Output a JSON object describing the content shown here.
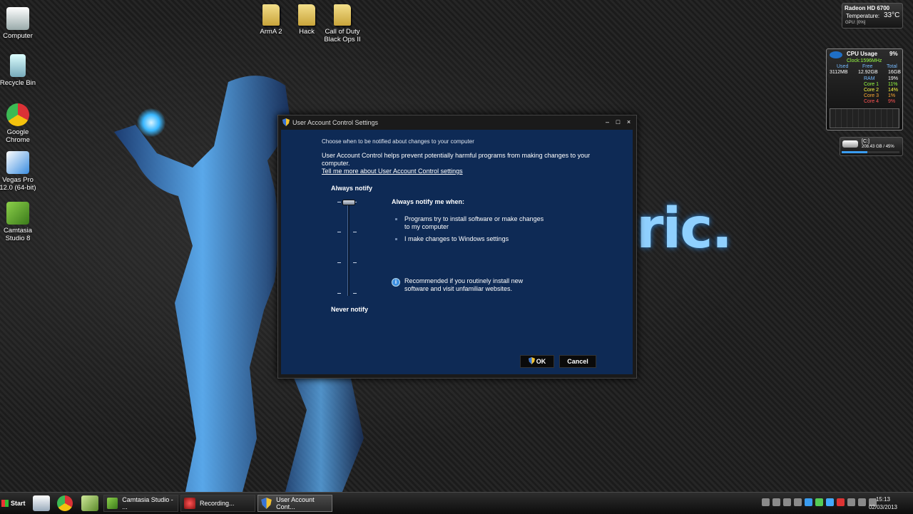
{
  "desktop": {
    "icons": [
      {
        "label": "Computer"
      },
      {
        "label": "Recycle Bin"
      },
      {
        "label": "Google Chrome"
      },
      {
        "label": "Vegas Pro 12.0 (64-bit)"
      },
      {
        "label": "Camtasia Studio 8"
      }
    ],
    "folders": [
      {
        "label": "ArmA 2"
      },
      {
        "label": "Hack"
      },
      {
        "label": "Call of Duty Black Ops II"
      }
    ],
    "brand_text": "ric."
  },
  "gadgets": {
    "gpu": {
      "name": "Radeon HD 6700",
      "temp_label": "Temperature:",
      "temp_value": "33°C",
      "gpu_load": "GPU: [0%]"
    },
    "cpu": {
      "title": "CPU Usage",
      "total": "9%",
      "clock": "Clock:1596MHz",
      "headers": [
        "Used",
        "Free",
        "Total"
      ],
      "memory": [
        "3112MB",
        "12.92GB",
        "16GB"
      ],
      "rows": [
        {
          "label": "RAM",
          "value": "19%"
        },
        {
          "label": "Core 1",
          "value": "11%"
        },
        {
          "label": "Core 2",
          "value": "14%"
        },
        {
          "label": "Core 3",
          "value": "1%"
        },
        {
          "label": "Core 4",
          "value": "9%"
        }
      ]
    },
    "drive": {
      "label": "[C:]",
      "value": "208.43 GB / 45%"
    }
  },
  "dialog": {
    "title": "User Account Control Settings",
    "choose_text": "Choose when to be notified about changes to your computer",
    "description": "User Account Control helps prevent potentially harmful programs from making changes to your computer.",
    "link": "Tell me more about User Account Control settings",
    "slider": {
      "top_label": "Always notify",
      "bottom_label": "Never notify",
      "level": 4,
      "levels": 4
    },
    "panel": {
      "heading": "Always notify me when:",
      "bullets": [
        "Programs try to install software or make changes to my computer",
        "I make changes to Windows settings"
      ],
      "info": "Recommended if you routinely install new software and visit unfamiliar websites."
    },
    "ok_label": "OK",
    "cancel_label": "Cancel"
  },
  "taskbar": {
    "start_label": "Start",
    "tasks": [
      {
        "label": "Camtasia Studio - ..."
      },
      {
        "label": "Recording..."
      },
      {
        "label": "User Account Cont..."
      }
    ],
    "time": "15:13",
    "date": "02/03/2013"
  },
  "colors": {
    "dialog_bg": "#0e2a55",
    "accent": "#39b7ff"
  }
}
